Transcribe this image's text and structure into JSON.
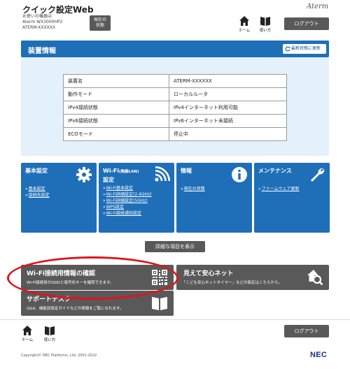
{
  "header": {
    "title": "クイック設定Web",
    "sub_lines": [
      "お使いの機器は",
      "Aterm  WX3000HP2",
      "ATERM-XXXXXX"
    ],
    "status_btn_line1": "現在の",
    "status_btn_line2": "状態",
    "brand": "Aterm",
    "home_label": "ホーム",
    "manual_label": "使い方",
    "logout_label": "ログアウト"
  },
  "device": {
    "title": "装置情報",
    "refresh_label": "最新状態に更新",
    "rows": [
      {
        "key": "装置名",
        "value": "ATERM-XXXXXX"
      },
      {
        "key": "動作モード",
        "value": "ローカルルータ"
      },
      {
        "key": "IPv4接続状態",
        "value": "IPv4インターネット利用可能"
      },
      {
        "key": "IPv6接続状態",
        "value": "IPv6インターネット未接続"
      },
      {
        "key": "ECOモード",
        "value": "停止中"
      }
    ]
  },
  "cards": {
    "basic": {
      "title": "基本設定",
      "icon": "gear-icon",
      "links": [
        "基本設定",
        "接続先設定"
      ]
    },
    "wifi": {
      "title_main": "Wi-Fi",
      "title_small": "(無線LAN)",
      "title_line2": "設定",
      "icon": "wifi-icon",
      "links": [
        "Wi-Fi基本設定",
        "Wi-Fi詳細設定(2.4GHz)",
        "Wi-Fi詳細設定(5GHz)",
        "WPS設定",
        "Wi-Fi接続通知設定"
      ]
    },
    "info": {
      "title": "情報",
      "icon": "info-icon",
      "links": [
        "現在の状態"
      ]
    },
    "maint": {
      "title": "メンテナンス",
      "icon": "wrench-icon",
      "links": [
        "ファームウェア更新"
      ]
    }
  },
  "detail_button": "詳細な項目を表示",
  "wide_cards": {
    "wifi_info": {
      "title": "Wi-Fi接続用情報の確認",
      "desc": "Wi-Fi接続用のSSIDと暗号化キーを確認できます。",
      "icon": "qr-code-icon"
    },
    "safety": {
      "title": "見えて安心ネット",
      "desc": "「こども安心ネットタイマー」などの設定はこちらから。",
      "icon": "home-search-icon"
    },
    "support": {
      "title": "サポートデスク",
      "desc": "Q&A、機能別設定ガイドなどの情報をご覧になれます。",
      "icon": "book-icon"
    }
  },
  "footer": {
    "home_label": "ホーム",
    "manual_label": "使い方",
    "logout_label": "ログアウト",
    "copyright": "Copyright© NEC Platforms, Ltd. 2001-2022",
    "logo": "NEC"
  },
  "colors": {
    "blue": "#1f6fb8",
    "gray_button": "#595959",
    "panel_bg": "#e4f1fa",
    "highlight_ring": "#e0141b"
  }
}
